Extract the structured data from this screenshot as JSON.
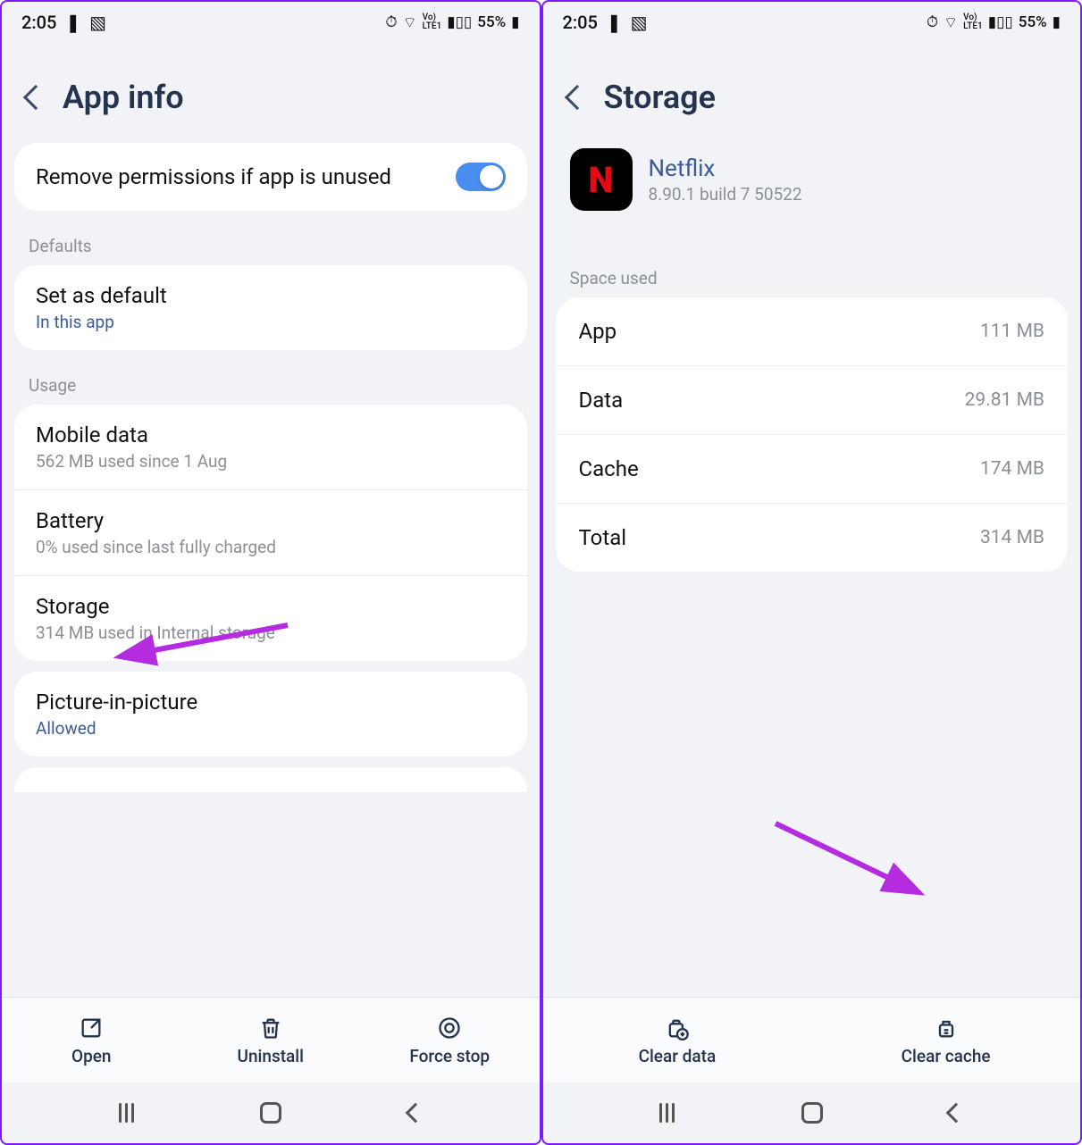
{
  "status": {
    "time": "2:05",
    "battery": "55%"
  },
  "left": {
    "title": "App info",
    "remove_perm_label": "Remove permissions if app is unused",
    "sections": {
      "defaults": "Defaults",
      "usage": "Usage"
    },
    "set_default": {
      "title": "Set as default",
      "sub": "In this app"
    },
    "mobile_data": {
      "title": "Mobile data",
      "sub": "562 MB used since 1 Aug"
    },
    "battery": {
      "title": "Battery",
      "sub": "0% used since last fully charged"
    },
    "storage": {
      "title": "Storage",
      "sub": "314 MB used in Internal storage"
    },
    "pip": {
      "title": "Picture-in-picture",
      "sub": "Allowed"
    },
    "actions": {
      "open": "Open",
      "uninstall": "Uninstall",
      "forcestop": "Force stop"
    }
  },
  "right": {
    "title": "Storage",
    "app": {
      "name": "Netflix",
      "version": "8.90.1 build 7 50522",
      "icon_letter": "N"
    },
    "section": "Space used",
    "rows": {
      "app": {
        "label": "App",
        "value": "111 MB"
      },
      "data": {
        "label": "Data",
        "value": "29.81 MB"
      },
      "cache": {
        "label": "Cache",
        "value": "174 MB"
      },
      "total": {
        "label": "Total",
        "value": "314 MB"
      }
    },
    "actions": {
      "clear_data": "Clear data",
      "clear_cache": "Clear cache"
    }
  }
}
